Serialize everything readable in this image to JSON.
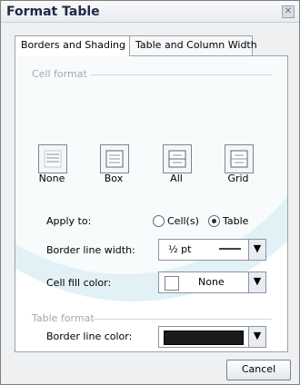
{
  "dialog": {
    "title": "Format Table",
    "close_glyph": "✕"
  },
  "tabs": [
    {
      "label": "Borders and Shading",
      "active": true
    },
    {
      "label": "Table and Column Width",
      "active": false
    }
  ],
  "cell_format": {
    "section_label": "Cell format",
    "presets": [
      {
        "label": "None"
      },
      {
        "label": "Box"
      },
      {
        "label": "All"
      },
      {
        "label": "Grid"
      }
    ],
    "apply_to": {
      "label": "Apply to:",
      "options": [
        {
          "label": "Cell(s)",
          "checked": false
        },
        {
          "label": "Table",
          "checked": true
        }
      ]
    },
    "border_width": {
      "label": "Border line width:",
      "value": "½ pt"
    },
    "fill_color": {
      "label": "Cell fill color:",
      "value": "None",
      "swatch": "#ffffff"
    }
  },
  "table_format": {
    "section_label": "Table format",
    "border_color": {
      "label": "Border line color:",
      "value": "#1a1a1a"
    }
  },
  "buttons": {
    "cancel": "Cancel"
  },
  "colors": {
    "accent_shape": "#e2f1f6"
  }
}
